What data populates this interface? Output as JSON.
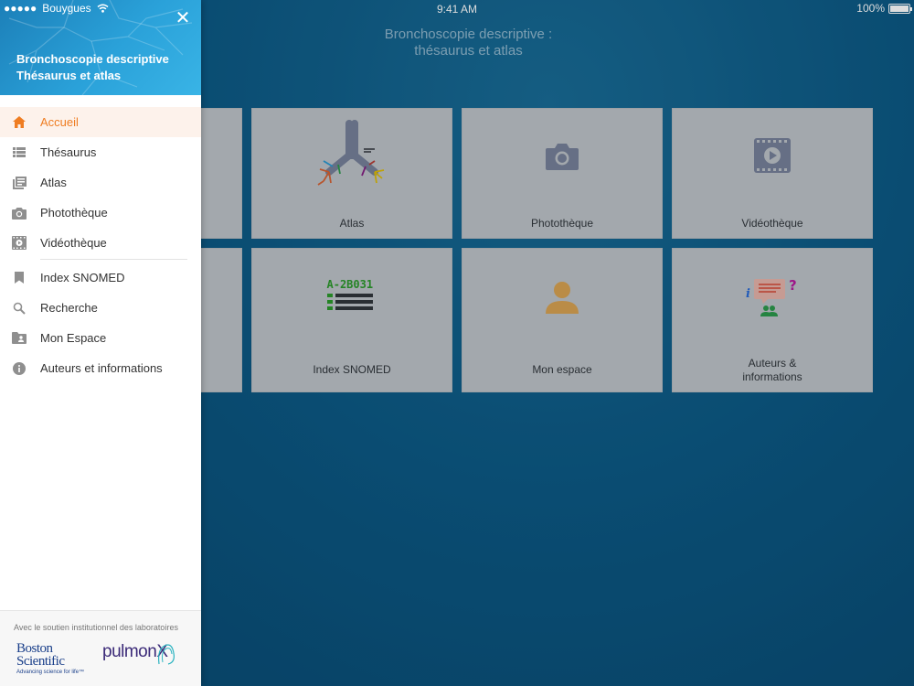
{
  "status_bar": {
    "carrier": "Bouygues",
    "signal": "●●●●●",
    "time": "9:41 AM",
    "battery": "100%",
    "battery_level": 1.0
  },
  "app": {
    "title_line1": "Bronchoscopie descriptive :",
    "title_line2": "thésaurus et atlas"
  },
  "tiles": [
    {
      "label": "Atlas",
      "icon": "bronchi-icon"
    },
    {
      "label": "Photothèque",
      "icon": "camera-icon"
    },
    {
      "label": "Vidéothèque",
      "icon": "video-icon"
    },
    {
      "label": "Index SNOMED",
      "icon": "snomed-index-icon",
      "icon_code": "A-2B031"
    },
    {
      "label": "Mon espace",
      "icon": "user-icon"
    },
    {
      "label": "Auteurs &\ninformations",
      "icon": "info-chat-icon"
    }
  ],
  "drawer": {
    "close_glyph": "✕",
    "title_line1": "Bronchoscopie descriptive",
    "title_line2": "Thésaurus et atlas",
    "menu": [
      {
        "label": "Accueil",
        "icon": "home-icon",
        "active": true
      },
      {
        "label": "Thésaurus",
        "icon": "list-icon"
      },
      {
        "label": "Atlas",
        "icon": "book-icon"
      },
      {
        "label": "Photothèque",
        "icon": "camera-icon"
      },
      {
        "label": "Vidéothèque",
        "icon": "film-icon"
      },
      {
        "label": "Index SNOMED",
        "icon": "bookmark-icon"
      },
      {
        "label": "Recherche",
        "icon": "search-icon"
      },
      {
        "label": "Mon Espace",
        "icon": "folder-user-icon"
      },
      {
        "label": "Auteurs et informations",
        "icon": "info-icon"
      }
    ],
    "footer": {
      "support_text": "Avec le soutien institutionnel des laboratoires",
      "logo1_line1": "Boston",
      "logo1_line2": "Scientific",
      "logo1_tagline": "Advancing science for life™",
      "logo2": "pulmonX"
    }
  },
  "colors": {
    "accent": "#ef7d22",
    "tile_bg": "#c7c7c7",
    "header_blue": "#2aa1d9",
    "background": "#0d5880"
  }
}
